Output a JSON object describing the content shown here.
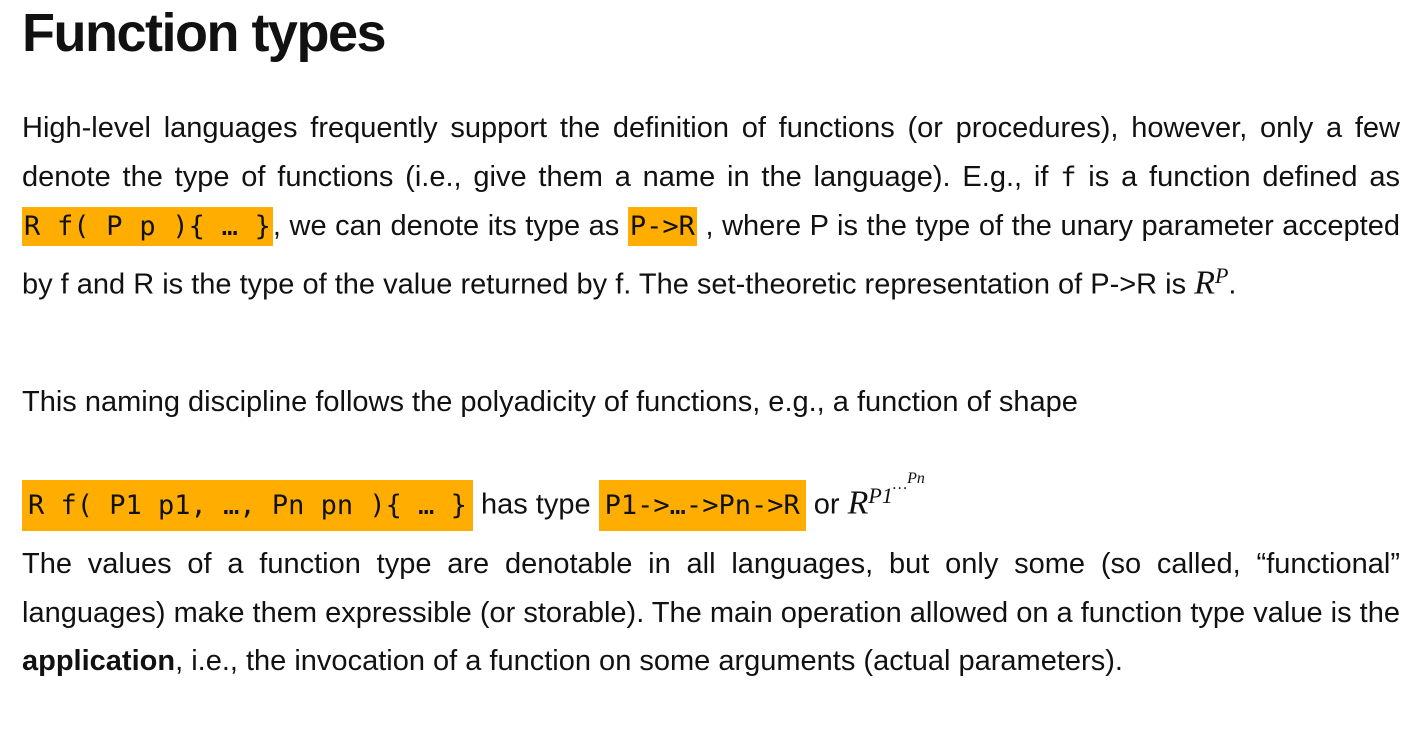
{
  "title": "Function types",
  "p1": {
    "a": "High-level languages frequently support the definition of functions (or procedures), however, only a few denote the type of functions (i.e., give them a name in the language). E.g., if ",
    "f1": "f",
    "b": " is a function defined as ",
    "code1": "R f( P p ){ … }",
    "c": ", we can denote its type as ",
    "code2": "P->R",
    "d": " , where P is the type of the unary parameter accepted by f and R is the type of the value returned by f. The set-theoretic representation of P->R is ",
    "math_base": "R",
    "math_exp": "P",
    "e": "."
  },
  "p2": "This naming discipline follows the polyadicity of functions, e.g., a function of shape",
  "p3": {
    "code1": "R f( P1 p1, …, Pn pn ){ … }",
    "a": " has type ",
    "code2": "P1->…->Pn->R",
    "b": " or ",
    "math_base": "R",
    "math_exp1": "P1",
    "math_dots": "…",
    "math_exp2": "Pn"
  },
  "p4": {
    "a": "The values of a function type are denotable in all languages, but only some (so called, “functional” languages) make them expressible (or storable). The main operation allowed on a function type value is the ",
    "bold": "application",
    "b": ", i.e., the invocation of a function on some arguments (actual parameters)."
  },
  "colors": {
    "highlight": "#ffad00"
  }
}
